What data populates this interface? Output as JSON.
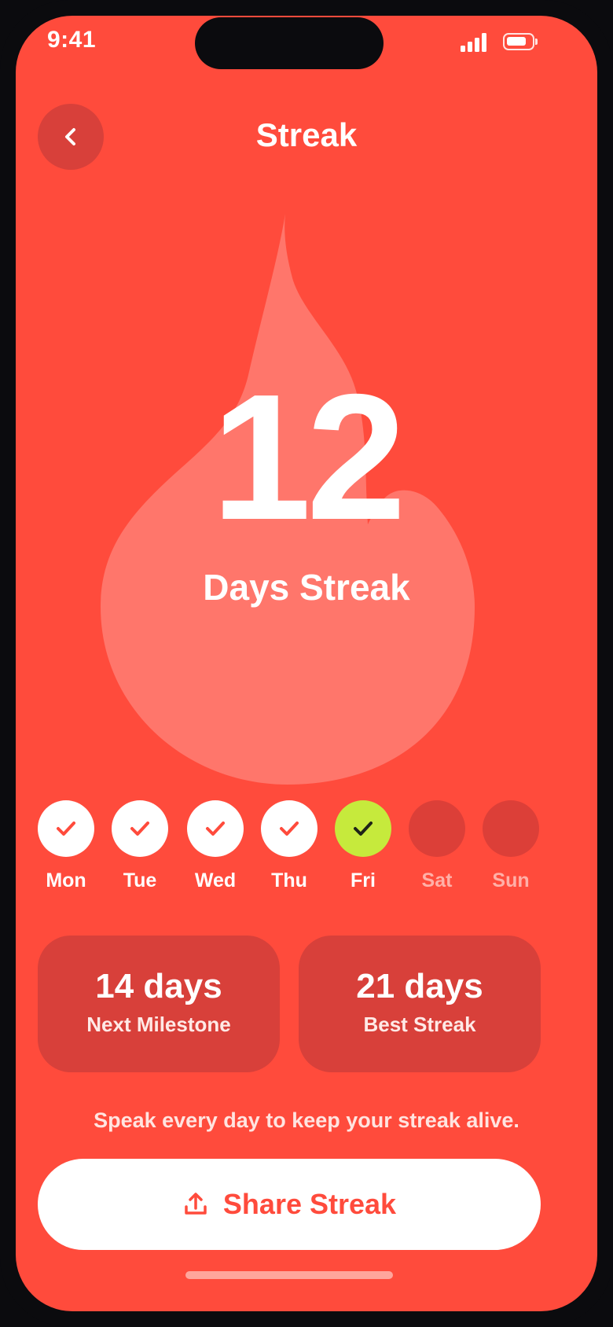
{
  "status_bar": {
    "time": "9:41"
  },
  "header": {
    "title": "Streak",
    "back_icon": "chevron-left-icon"
  },
  "streak": {
    "count": "12",
    "label": "Days Streak"
  },
  "week": [
    {
      "label": "Mon",
      "state": "done"
    },
    {
      "label": "Tue",
      "state": "done"
    },
    {
      "label": "Wed",
      "state": "done"
    },
    {
      "label": "Thu",
      "state": "done"
    },
    {
      "label": "Fri",
      "state": "today"
    },
    {
      "label": "Sat",
      "state": "pending"
    },
    {
      "label": "Sun",
      "state": "pending"
    }
  ],
  "stats": {
    "next_milestone": {
      "value": "14 days",
      "caption": "Next Milestone"
    },
    "best_streak": {
      "value": "21 days",
      "caption": "Best Streak"
    }
  },
  "hint": "Speak every day to keep your streak alive.",
  "share": {
    "label": "Share Streak",
    "icon": "share-upload-icon"
  },
  "colors": {
    "background": "#ff4b3c",
    "card": "#d8403a",
    "flame": "#ff766b",
    "today": "#c6ea3c",
    "check_done": "#ff4b3c",
    "check_today": "#1f2418"
  }
}
